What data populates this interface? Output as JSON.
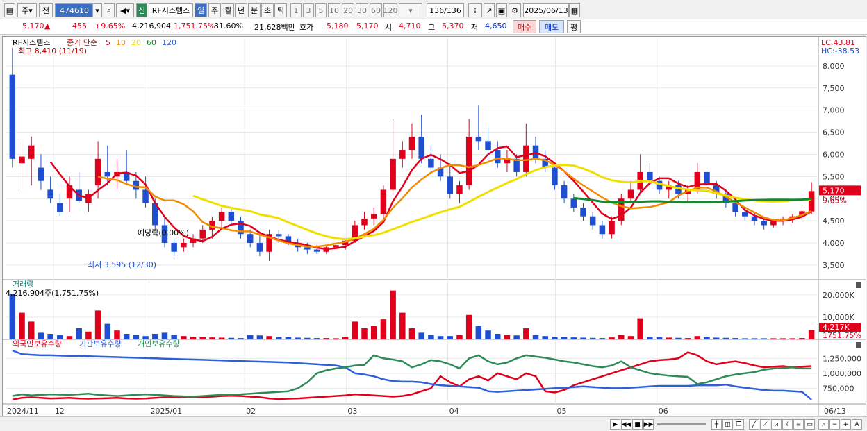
{
  "toolbar": {
    "period_selected": "주",
    "prev_label": "전",
    "stock_code": "474610",
    "new_badge": "신",
    "stock_name": "RF시스템즈",
    "cycle_buttons": [
      "일",
      "주",
      "월",
      "년",
      "분",
      "초",
      "틱"
    ],
    "interval_buttons": [
      "1",
      "3",
      "5",
      "10",
      "20",
      "30",
      "60",
      "120"
    ],
    "count_display": "136/136",
    "date_value": "2025/06/13"
  },
  "quote": {
    "price": "5,170",
    "change_arrow": "▲",
    "change": "455",
    "change_pct": "+9.65%",
    "volume": "4,216,904",
    "volume_ratio": "1,751.75%",
    "turnover_pct": "31.60%",
    "amount": "21,628백만",
    "bid_label": "호가",
    "bid": "5,180",
    "ask": "5,170",
    "open_label": "시",
    "open": "4,710",
    "high_label": "고",
    "high": "5,370",
    "low_label": "저",
    "low": "4,650",
    "buy_label": "매수",
    "sell_label": "매도",
    "eval_label": "평"
  },
  "price_panel": {
    "legend_name": "RF시스템즈",
    "legend_ma_title": "종가 단순",
    "ma_labels": [
      "5",
      "10",
      "20",
      "60",
      "120"
    ],
    "ma_colors": [
      "#e0001c",
      "#f08c00",
      "#f0e000",
      "#138a2e",
      "#2d5fd6"
    ],
    "high_note": "최고 8,410 (11/19)",
    "low_note": "최저 3,595 (12/30)",
    "mid_note": "예당락(0.00%)",
    "lc_label": "LC:43.81",
    "hc_label": "HC:-38.53",
    "last_price_tag": "5,170",
    "last_pct_tag": "9.65%"
  },
  "volume_panel": {
    "title": "거래량",
    "value_label": "4,216,904주(1,751.75%)",
    "last_tag": "4,217K",
    "last_pct_tag": "1751.75%"
  },
  "holding_panel": {
    "titles": [
      "외국인보유수량",
      "기관보유수량",
      "개인보유수량"
    ],
    "colors": [
      "#e0001c",
      "#2d5fd6",
      "#2e8b57"
    ]
  },
  "x_axis": {
    "labels": [
      "2024/11",
      "12",
      "2025/01",
      "02",
      "03",
      "04",
      "05",
      "06",
      "06/13"
    ]
  },
  "chart_data": [
    {
      "type": "candlestick",
      "title": "RF시스템즈",
      "y_ticks": [
        3500,
        4000,
        4500,
        5000,
        5500,
        6000,
        6500,
        7000,
        7500,
        8000
      ],
      "ylim": [
        3200,
        8500
      ],
      "ohlc": [
        [
          7800,
          8410,
          5700,
          5900
        ],
        [
          5800,
          6300,
          5200,
          5950
        ],
        [
          5900,
          6400,
          5300,
          6200
        ],
        [
          5700,
          6000,
          5200,
          5400
        ],
        [
          5200,
          5500,
          4900,
          5000
        ],
        [
          4900,
          5100,
          4600,
          4700
        ],
        [
          5000,
          5500,
          4700,
          5300
        ],
        [
          5200,
          5600,
          4900,
          4950
        ],
        [
          4900,
          5200,
          4700,
          5100
        ],
        [
          5300,
          6300,
          5000,
          5900
        ],
        [
          5600,
          6200,
          5300,
          5500
        ],
        [
          5500,
          5900,
          5200,
          5600
        ],
        [
          5600,
          6100,
          5300,
          5400
        ],
        [
          5400,
          5600,
          5000,
          5200
        ],
        [
          5200,
          5500,
          4800,
          4900
        ],
        [
          4900,
          5000,
          4300,
          4400
        ],
        [
          4400,
          4600,
          3900,
          4000
        ],
        [
          4000,
          4100,
          3700,
          3800
        ],
        [
          3900,
          4100,
          3800,
          4000
        ],
        [
          4000,
          4200,
          3900,
          4100
        ],
        [
          4100,
          4400,
          4000,
          4300
        ],
        [
          4300,
          4600,
          4100,
          4500
        ],
        [
          4500,
          4800,
          4300,
          4700
        ],
        [
          4700,
          4800,
          4400,
          4500
        ],
        [
          4500,
          4600,
          4100,
          4200
        ],
        [
          4200,
          4300,
          3900,
          4000
        ],
        [
          4000,
          4200,
          3700,
          3800
        ],
        [
          3800,
          4300,
          3595,
          4200
        ],
        [
          4200,
          4300,
          4000,
          4150
        ],
        [
          4150,
          4200,
          3950,
          4000
        ],
        [
          4000,
          4100,
          3800,
          3900
        ],
        [
          3900,
          4000,
          3750,
          3850
        ],
        [
          3850,
          3950,
          3750,
          3800
        ],
        [
          3800,
          3950,
          3750,
          3900
        ],
        [
          3900,
          4000,
          3850,
          3950
        ],
        [
          3950,
          4100,
          3850,
          4050
        ],
        [
          4050,
          4500,
          4000,
          4400
        ],
        [
          4400,
          4700,
          4300,
          4550
        ],
        [
          4550,
          4800,
          4400,
          4650
        ],
        [
          4650,
          5300,
          4550,
          5200
        ],
        [
          5200,
          6800,
          5100,
          5900
        ],
        [
          5900,
          6300,
          5700,
          6100
        ],
        [
          6100,
          6700,
          5900,
          6400
        ],
        [
          6400,
          6900,
          5800,
          5900
        ],
        [
          5900,
          6200,
          5600,
          5700
        ],
        [
          5700,
          6000,
          5400,
          5500
        ],
        [
          5500,
          5800,
          5000,
          5100
        ],
        [
          5100,
          5400,
          4900,
          5300
        ],
        [
          5300,
          6800,
          5200,
          6400
        ],
        [
          6400,
          7100,
          6100,
          6300
        ],
        [
          6300,
          6600,
          5900,
          6100
        ],
        [
          6100,
          6300,
          5700,
          5800
        ],
        [
          5800,
          6100,
          5600,
          5900
        ],
        [
          5900,
          6000,
          5500,
          5600
        ],
        [
          5600,
          6700,
          5500,
          6200
        ],
        [
          6200,
          6400,
          5800,
          5900
        ],
        [
          5900,
          6100,
          5600,
          5700
        ],
        [
          5700,
          5800,
          5200,
          5300
        ],
        [
          5300,
          5400,
          4900,
          5000
        ],
        [
          5000,
          5100,
          4700,
          4800
        ],
        [
          4800,
          4900,
          4500,
          4600
        ],
        [
          4600,
          4700,
          4300,
          4400
        ],
        [
          4400,
          4500,
          4100,
          4200
        ],
        [
          4200,
          4600,
          4100,
          4500
        ],
        [
          4500,
          5100,
          4400,
          5000
        ],
        [
          5000,
          5400,
          4900,
          5200
        ],
        [
          5200,
          6000,
          5100,
          5600
        ],
        [
          5600,
          5800,
          5300,
          5400
        ],
        [
          5400,
          5500,
          5100,
          5200
        ],
        [
          5200,
          5400,
          5000,
          5300
        ],
        [
          5300,
          5400,
          5000,
          5100
        ],
        [
          5100,
          5300,
          4900,
          5200
        ],
        [
          5200,
          5800,
          5100,
          5600
        ],
        [
          5600,
          5700,
          5200,
          5300
        ],
        [
          5300,
          5400,
          5000,
          5100
        ],
        [
          5100,
          5200,
          4800,
          4900
        ],
        [
          4900,
          5000,
          4600,
          4700
        ],
        [
          4700,
          4800,
          4500,
          4600
        ],
        [
          4600,
          4700,
          4400,
          4500
        ],
        [
          4500,
          4600,
          4300,
          4400
        ],
        [
          4400,
          4550,
          4350,
          4500
        ],
        [
          4500,
          4600,
          4400,
          4550
        ],
        [
          4550,
          4650,
          4450,
          4600
        ],
        [
          4600,
          4750,
          4550,
          4715
        ],
        [
          4710,
          5370,
          4650,
          5170
        ]
      ],
      "ma_series": [
        {
          "name": "5",
          "values": [
            null,
            null,
            null,
            null,
            5830,
            5550,
            5280,
            5070,
            5010,
            5190,
            5350,
            5570,
            5590,
            5520,
            5320,
            4900,
            4590,
            4350,
            4160,
            4080,
            4040,
            4140,
            4320,
            4410,
            4440,
            4380,
            4230,
            4140,
            4070,
            4030,
            3990,
            3950,
            3890,
            3860,
            3880,
            3910,
            4040,
            4150,
            4270,
            4470,
            4940,
            5270,
            5650,
            5900,
            5990,
            5890,
            5760,
            5580,
            5620,
            5770,
            6000,
            6140,
            6180,
            5940,
            5980,
            6030,
            5960,
            5800,
            5620,
            5400,
            5160,
            4910,
            4660,
            4540,
            4620,
            4800,
            5130,
            5350,
            5460,
            5460,
            5340,
            5260,
            5320,
            5330,
            5330,
            5180,
            4980,
            4740,
            4620,
            4540,
            4500,
            4500,
            4530,
            4590,
            4710
          ]
        },
        {
          "name": "10",
          "values": [
            null,
            null,
            null,
            null,
            null,
            null,
            null,
            null,
            null,
            5500,
            5450,
            5420,
            5330,
            5265,
            5255,
            5045,
            4960,
            4960,
            4875,
            4715,
            4470,
            4365,
            4335,
            4285,
            4260,
            4260,
            4185,
            4125,
            4055,
            3990,
            3950,
            3915,
            3915,
            3945,
            3985,
            4025,
            4095,
            4200,
            4320,
            4515,
            4795,
            5010,
            5255,
            5435,
            5590,
            5690,
            5760,
            5755,
            5710,
            5760,
            5830,
            5910,
            5900,
            5870,
            5870,
            5900,
            5870,
            5760,
            5620,
            5450,
            5300,
            5165,
            5025,
            4910,
            4830,
            4780,
            4795,
            4810,
            4860,
            4920,
            5070,
            5170,
            5250,
            5250,
            5160,
            5040,
            4920,
            4800,
            4690,
            4575,
            4520,
            4510,
            4560,
            4630,
            4720
          ]
        }
      ]
    },
    {
      "type": "bar",
      "title": "거래량",
      "y_ticks": [
        "10,000K",
        "20,000K"
      ],
      "values": [
        20500,
        12000,
        8000,
        3000,
        2500,
        2000,
        1500,
        5000,
        3500,
        13000,
        7000,
        4000,
        2500,
        2000,
        1500,
        2500,
        3000,
        2000,
        1500,
        1200,
        1000,
        900,
        800,
        700,
        600,
        2000,
        1800,
        1500,
        1200,
        1000,
        800,
        700,
        600,
        600,
        500,
        1000,
        8000,
        5000,
        6000,
        9000,
        22000,
        12000,
        5000,
        3000,
        2000,
        1500,
        1500,
        2000,
        11000,
        6000,
        4000,
        2500,
        2000,
        1800,
        5000,
        2000,
        1500,
        1200,
        1000,
        900,
        800,
        700,
        600,
        900,
        2000,
        1500,
        9500,
        1200,
        1000,
        800,
        700,
        600,
        1500,
        1000,
        800,
        700,
        600,
        500,
        500,
        500,
        500,
        500,
        500,
        600,
        4217
      ]
    },
    {
      "type": "line",
      "title": "외국인보유수량 / 기관보유수량 / 개인보유수량",
      "y_ticks": [
        "750,000",
        "1,000,000",
        "1,250,000"
      ],
      "series": [
        {
          "name": "외국인보유수량",
          "values": [
            560000,
            590000,
            600000,
            590000,
            580000,
            585000,
            590000,
            580000,
            575000,
            580000,
            585000,
            590000,
            580000,
            575000,
            580000,
            590000,
            600000,
            595000,
            600000,
            605000,
            600000,
            610000,
            620000,
            625000,
            620000,
            610000,
            600000,
            580000,
            570000,
            575000,
            580000,
            590000,
            600000,
            610000,
            620000,
            630000,
            650000,
            640000,
            630000,
            620000,
            610000,
            620000,
            650000,
            700000,
            750000,
            950000,
            850000,
            780000,
            900000,
            950000,
            880000,
            1000000,
            950000,
            900000,
            1000000,
            950000,
            700000,
            680000,
            720000,
            800000,
            850000,
            900000,
            950000,
            1000000,
            1050000,
            1100000,
            1150000,
            1200000,
            1220000,
            1230000,
            1250000,
            1350000,
            1300000,
            1200000,
            1150000,
            1180000,
            1200000,
            1170000,
            1130000,
            1100000,
            1110000,
            1120000,
            1100000,
            1110000,
            1120000
          ]
        },
        {
          "name": "기관보유수량",
          "values": [
            1380000,
            1320000,
            1310000,
            1300000,
            1300000,
            1295000,
            1290000,
            1290000,
            1285000,
            1280000,
            1275000,
            1270000,
            1265000,
            1260000,
            1255000,
            1250000,
            1245000,
            1240000,
            1235000,
            1230000,
            1225000,
            1220000,
            1215000,
            1210000,
            1205000,
            1200000,
            1195000,
            1190000,
            1185000,
            1180000,
            1170000,
            1160000,
            1150000,
            1140000,
            1130000,
            1100000,
            1000000,
            980000,
            950000,
            900000,
            870000,
            860000,
            860000,
            850000,
            820000,
            800000,
            790000,
            780000,
            770000,
            760000,
            700000,
            690000,
            700000,
            710000,
            720000,
            730000,
            740000,
            750000,
            760000,
            770000,
            780000,
            770000,
            760000,
            750000,
            750000,
            760000,
            770000,
            780000,
            790000,
            790000,
            790000,
            790000,
            800000,
            800000,
            800000,
            810000,
            780000,
            760000,
            740000,
            720000,
            710000,
            710000,
            700000,
            690000,
            560000
          ]
        },
        {
          "name": "개인보유수량",
          "values": [
            620000,
            650000,
            630000,
            640000,
            650000,
            645000,
            640000,
            650000,
            660000,
            640000,
            630000,
            620000,
            630000,
            640000,
            650000,
            640000,
            630000,
            620000,
            615000,
            610000,
            620000,
            630000,
            640000,
            645000,
            650000,
            660000,
            670000,
            680000,
            690000,
            700000,
            750000,
            850000,
            1000000,
            1050000,
            1080000,
            1100000,
            1130000,
            1140000,
            1300000,
            1250000,
            1230000,
            1200000,
            1100000,
            1150000,
            1220000,
            1200000,
            1150000,
            1080000,
            1250000,
            1300000,
            1200000,
            1150000,
            1180000,
            1250000,
            1300000,
            1280000,
            1260000,
            1230000,
            1200000,
            1180000,
            1150000,
            1120000,
            1100000,
            1130000,
            1200000,
            1100000,
            1050000,
            1000000,
            980000,
            960000,
            950000,
            940000,
            820000,
            850000,
            900000,
            950000,
            980000,
            1000000,
            1020000,
            1060000,
            1080000,
            1090000,
            1100000,
            1080000,
            1080000
          ]
        }
      ]
    }
  ]
}
